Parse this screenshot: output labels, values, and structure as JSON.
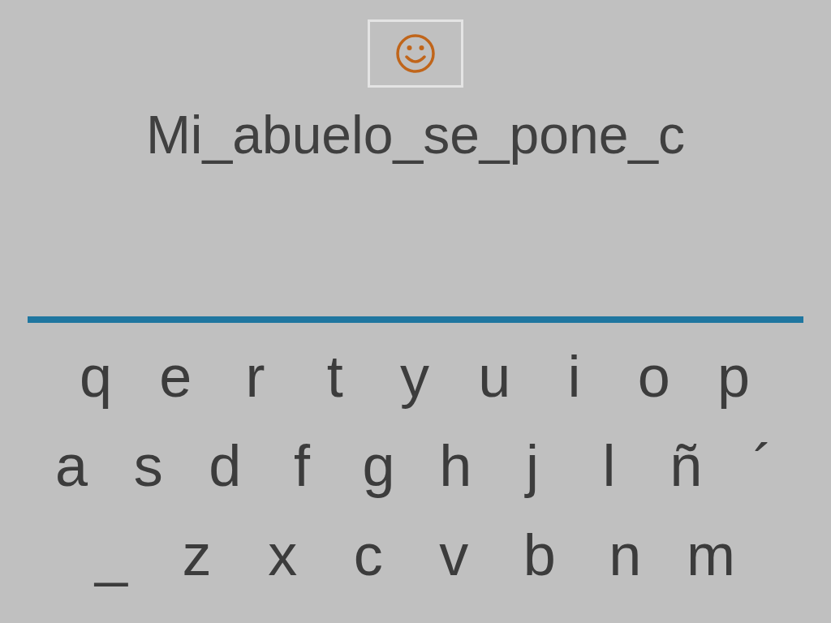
{
  "sentence": "Mi_abuelo_se_pone_c",
  "keyboard": {
    "rows": [
      [
        "q",
        "e",
        "r",
        "t",
        "y",
        "u",
        "i",
        "o",
        "p"
      ],
      [
        "a",
        "s",
        "d",
        "f",
        "g",
        "h",
        "j",
        "l",
        "ñ",
        "´"
      ],
      [
        "_",
        "z",
        "x",
        "c",
        "v",
        "b",
        "n",
        "m"
      ]
    ]
  }
}
